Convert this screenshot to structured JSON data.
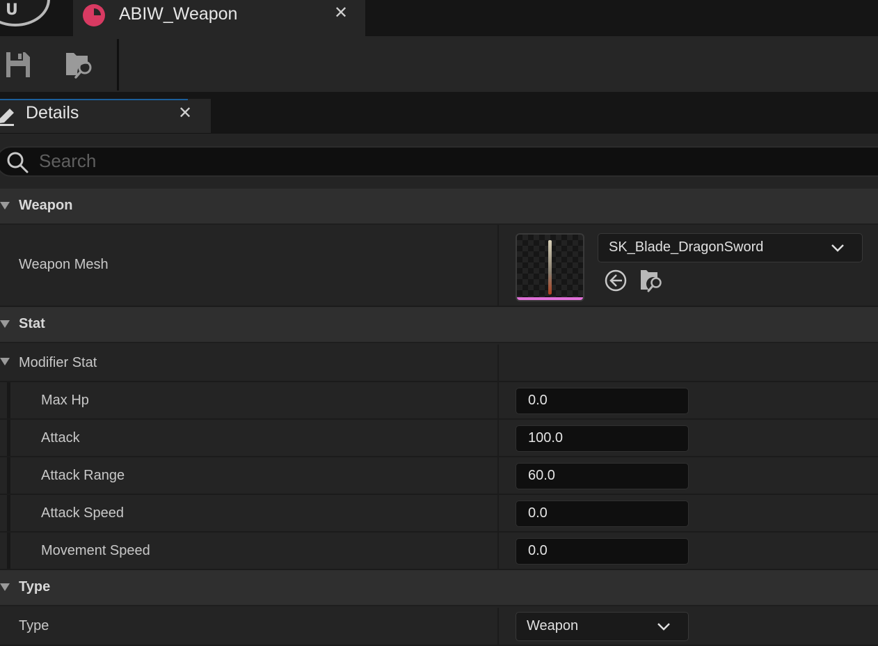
{
  "window": {
    "tab_title": "ABIW_Weapon",
    "tab_close": "✕"
  },
  "toolbar": {
    "save_icon": "save-icon",
    "browse_icon": "browse-folder-icon"
  },
  "details": {
    "title": "Details",
    "close": "✕",
    "search_placeholder": "Search"
  },
  "categories": {
    "weapon": "Weapon",
    "stat": "Stat",
    "type": "Type"
  },
  "weapon_mesh": {
    "label": "Weapon Mesh",
    "value": "SK_Blade_DragonSword"
  },
  "modifier_stat": {
    "label": "Modifier Stat",
    "fields": [
      {
        "label": "Max Hp",
        "value": "0.0"
      },
      {
        "label": "Attack",
        "value": "100.0"
      },
      {
        "label": "Attack Range",
        "value": "60.0"
      },
      {
        "label": "Attack Speed",
        "value": "0.0"
      },
      {
        "label": "Movement Speed",
        "value": "0.0"
      }
    ]
  },
  "type_field": {
    "label": "Type",
    "value": "Weapon"
  },
  "colors": {
    "asset_icon": "#d83a62",
    "thumbnail_bar": "#e070d8",
    "tab_accent": "#1b5e9a"
  }
}
